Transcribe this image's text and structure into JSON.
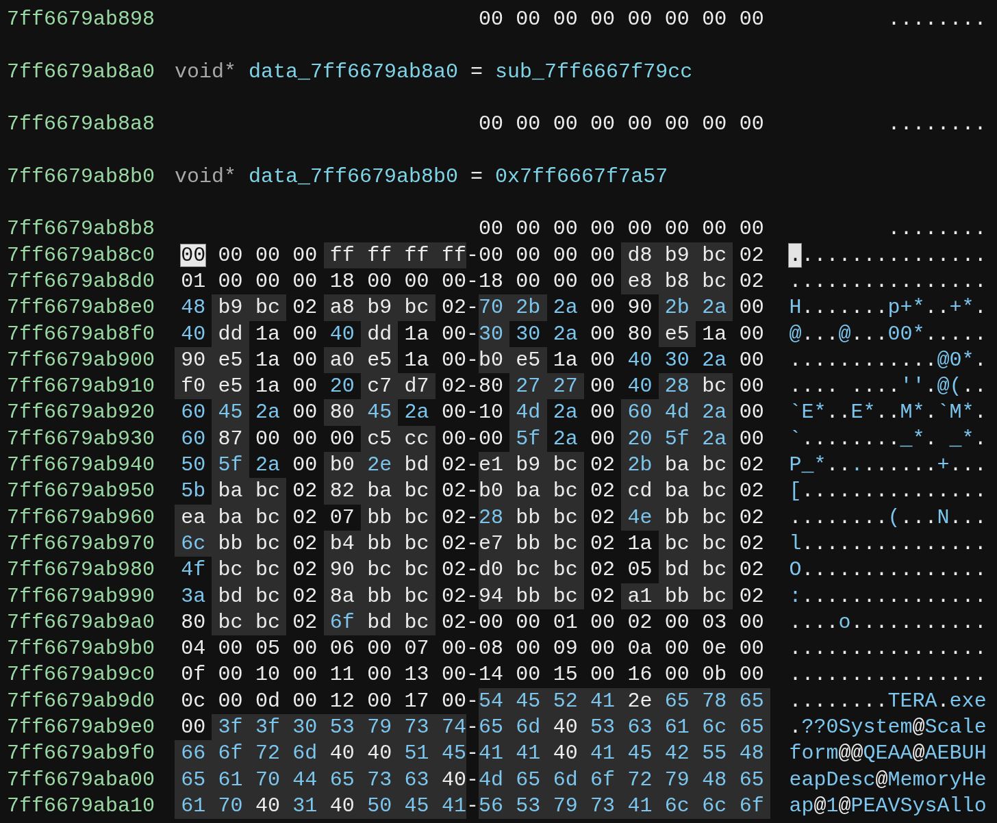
{
  "rows": [
    {
      "kind": "partial",
      "address": "7ff6679ab898",
      "bytes": [
        "00",
        "00",
        "00",
        "00",
        "00",
        "00",
        "00",
        "00"
      ],
      "ascii": "........"
    },
    {
      "kind": "declaration",
      "address": "7ff6679ab8a0",
      "type": "void*",
      "name": "data_7ff6679ab8a0",
      "operator": "=",
      "value": "sub_7ff6667f79cc"
    },
    {
      "kind": "partial",
      "address": "7ff6679ab8a8",
      "bytes": [
        "00",
        "00",
        "00",
        "00",
        "00",
        "00",
        "00",
        "00"
      ],
      "ascii": "........"
    },
    {
      "kind": "declaration",
      "address": "7ff6679ab8b0",
      "type": "void*",
      "name": "data_7ff6679ab8b0",
      "operator": "=",
      "value": "0x7ff6667f7a57"
    },
    {
      "kind": "partial",
      "address": "7ff6679ab8b8",
      "bytes": [
        "00",
        "00",
        "00",
        "00",
        "00",
        "00",
        "00",
        "00"
      ],
      "ascii": "........"
    },
    {
      "kind": "hex",
      "address": "7ff6679ab8c0",
      "selected": true,
      "separator": "-",
      "ascii": "................",
      "bytes": [
        "00",
        "00",
        "00",
        "00",
        "ff",
        "ff",
        "ff",
        "ff",
        "00",
        "00",
        "00",
        "00",
        "d8",
        "b9",
        "bc",
        "02"
      ],
      "printable": [
        false,
        false,
        false,
        false,
        false,
        false,
        false,
        false,
        false,
        false,
        false,
        false,
        false,
        false,
        false,
        false
      ],
      "shaded": [
        false,
        false,
        false,
        false,
        true,
        true,
        true,
        true,
        false,
        false,
        false,
        false,
        true,
        true,
        true,
        false
      ]
    },
    {
      "kind": "hex",
      "address": "7ff6679ab8d0",
      "selected": false,
      "separator": "-",
      "ascii": "................",
      "bytes": [
        "01",
        "00",
        "00",
        "00",
        "18",
        "00",
        "00",
        "00",
        "18",
        "00",
        "00",
        "00",
        "e8",
        "b8",
        "bc",
        "02"
      ],
      "printable": [
        false,
        false,
        false,
        false,
        false,
        false,
        false,
        false,
        false,
        false,
        false,
        false,
        false,
        false,
        false,
        false
      ],
      "shaded": [
        false,
        false,
        false,
        false,
        false,
        false,
        false,
        false,
        false,
        false,
        false,
        false,
        true,
        true,
        true,
        false
      ]
    },
    {
      "kind": "hex",
      "address": "7ff6679ab8e0",
      "selected": false,
      "separator": "-",
      "ascii": "H.......p+*..+*.",
      "bytes": [
        "48",
        "b9",
        "bc",
        "02",
        "a8",
        "b9",
        "bc",
        "02",
        "70",
        "2b",
        "2a",
        "00",
        "90",
        "2b",
        "2a",
        "00"
      ],
      "printable": [
        true,
        false,
        false,
        false,
        false,
        false,
        false,
        false,
        true,
        true,
        true,
        false,
        false,
        true,
        true,
        false
      ],
      "shaded": [
        false,
        true,
        true,
        false,
        true,
        true,
        true,
        false,
        true,
        true,
        false,
        false,
        false,
        true,
        true,
        false
      ]
    },
    {
      "kind": "hex",
      "address": "7ff6679ab8f0",
      "selected": false,
      "separator": "-",
      "ascii": "@...@...00*.....",
      "bytes": [
        "40",
        "dd",
        "1a",
        "00",
        "40",
        "dd",
        "1a",
        "00",
        "30",
        "30",
        "2a",
        "00",
        "80",
        "e5",
        "1a",
        "00"
      ],
      "printable": [
        true,
        false,
        false,
        false,
        true,
        false,
        false,
        false,
        true,
        true,
        true,
        false,
        false,
        false,
        false,
        false
      ],
      "shaded": [
        false,
        true,
        false,
        false,
        false,
        true,
        false,
        false,
        true,
        false,
        false,
        false,
        false,
        true,
        false,
        false
      ]
    },
    {
      "kind": "hex",
      "address": "7ff6679ab900",
      "selected": false,
      "separator": "-",
      "ascii": "............@0*.",
      "bytes": [
        "90",
        "e5",
        "1a",
        "00",
        "a0",
        "e5",
        "1a",
        "00",
        "b0",
        "e5",
        "1a",
        "00",
        "40",
        "30",
        "2a",
        "00"
      ],
      "printable": [
        false,
        false,
        false,
        false,
        false,
        false,
        false,
        false,
        false,
        false,
        false,
        false,
        true,
        true,
        true,
        false
      ],
      "shaded": [
        true,
        true,
        false,
        false,
        true,
        true,
        false,
        false,
        true,
        true,
        false,
        false,
        false,
        false,
        false,
        false
      ]
    },
    {
      "kind": "hex",
      "address": "7ff6679ab910",
      "selected": false,
      "separator": "-",
      "ascii": ".... ....''.@(..",
      "bytes": [
        "f0",
        "e5",
        "1a",
        "00",
        "20",
        "c7",
        "d7",
        "02",
        "80",
        "27",
        "27",
        "00",
        "40",
        "28",
        "bc",
        "00"
      ],
      "printable": [
        false,
        false,
        false,
        false,
        true,
        false,
        false,
        false,
        false,
        true,
        true,
        false,
        true,
        true,
        false,
        false
      ],
      "shaded": [
        true,
        true,
        false,
        false,
        false,
        true,
        true,
        false,
        false,
        true,
        true,
        false,
        false,
        true,
        true,
        false
      ]
    },
    {
      "kind": "hex",
      "address": "7ff6679ab920",
      "selected": false,
      "separator": "-",
      "ascii": "`E*..E*..M*.`M*.",
      "bytes": [
        "60",
        "45",
        "2a",
        "00",
        "80",
        "45",
        "2a",
        "00",
        "10",
        "4d",
        "2a",
        "00",
        "60",
        "4d",
        "2a",
        "00"
      ],
      "printable": [
        true,
        true,
        true,
        false,
        false,
        true,
        true,
        false,
        false,
        true,
        true,
        false,
        true,
        true,
        true,
        false
      ],
      "shaded": [
        false,
        true,
        false,
        false,
        true,
        true,
        false,
        false,
        false,
        true,
        false,
        false,
        true,
        true,
        true,
        false
      ]
    },
    {
      "kind": "hex",
      "address": "7ff6679ab930",
      "selected": false,
      "separator": "-",
      "ascii": "`........_*. _*.",
      "bytes": [
        "60",
        "87",
        "00",
        "00",
        "00",
        "c5",
        "cc",
        "00",
        "00",
        "5f",
        "2a",
        "00",
        "20",
        "5f",
        "2a",
        "00"
      ],
      "printable": [
        true,
        false,
        false,
        false,
        false,
        false,
        false,
        false,
        false,
        true,
        true,
        false,
        true,
        true,
        true,
        false
      ],
      "shaded": [
        false,
        true,
        false,
        false,
        false,
        true,
        true,
        false,
        false,
        true,
        false,
        false,
        true,
        true,
        true,
        false
      ]
    },
    {
      "kind": "hex",
      "address": "7ff6679ab940",
      "selected": false,
      "separator": "-",
      "ascii": "P_*.........+...",
      "bytes": [
        "50",
        "5f",
        "2a",
        "00",
        "b0",
        "2e",
        "bd",
        "02",
        "e1",
        "b9",
        "bc",
        "02",
        "2b",
        "ba",
        "bc",
        "02"
      ],
      "printable": [
        true,
        true,
        true,
        false,
        false,
        true,
        false,
        false,
        false,
        false,
        false,
        false,
        true,
        false,
        false,
        false
      ],
      "shaded": [
        false,
        true,
        false,
        false,
        true,
        true,
        true,
        false,
        true,
        true,
        true,
        false,
        true,
        true,
        true,
        false
      ]
    },
    {
      "kind": "hex",
      "address": "7ff6679ab950",
      "selected": false,
      "separator": "-",
      "ascii": "[...............",
      "bytes": [
        "5b",
        "ba",
        "bc",
        "02",
        "82",
        "ba",
        "bc",
        "02",
        "b0",
        "ba",
        "bc",
        "02",
        "cd",
        "ba",
        "bc",
        "02"
      ],
      "printable": [
        true,
        false,
        false,
        false,
        false,
        false,
        false,
        false,
        false,
        false,
        false,
        false,
        false,
        false,
        false,
        false
      ],
      "shaded": [
        false,
        true,
        true,
        false,
        true,
        true,
        true,
        false,
        true,
        true,
        true,
        false,
        true,
        true,
        true,
        false
      ]
    },
    {
      "kind": "hex",
      "address": "7ff6679ab960",
      "selected": false,
      "separator": "-",
      "ascii": "........(...N...",
      "bytes": [
        "ea",
        "ba",
        "bc",
        "02",
        "07",
        "bb",
        "bc",
        "02",
        "28",
        "bb",
        "bc",
        "02",
        "4e",
        "bb",
        "bc",
        "02"
      ],
      "printable": [
        false,
        false,
        false,
        false,
        false,
        false,
        false,
        false,
        true,
        false,
        false,
        false,
        true,
        false,
        false,
        false
      ],
      "shaded": [
        true,
        true,
        true,
        false,
        false,
        true,
        true,
        false,
        true,
        true,
        true,
        false,
        true,
        true,
        true,
        false
      ]
    },
    {
      "kind": "hex",
      "address": "7ff6679ab970",
      "selected": false,
      "separator": "-",
      "ascii": "l...............",
      "bytes": [
        "6c",
        "bb",
        "bc",
        "02",
        "b4",
        "bb",
        "bc",
        "02",
        "e7",
        "bb",
        "bc",
        "02",
        "1a",
        "bc",
        "bc",
        "02"
      ],
      "printable": [
        true,
        false,
        false,
        false,
        false,
        false,
        false,
        false,
        false,
        false,
        false,
        false,
        false,
        false,
        false,
        false
      ],
      "shaded": [
        true,
        true,
        true,
        false,
        true,
        true,
        true,
        false,
        true,
        true,
        true,
        false,
        false,
        true,
        true,
        false
      ]
    },
    {
      "kind": "hex",
      "address": "7ff6679ab980",
      "selected": false,
      "separator": "-",
      "ascii": "O...............",
      "bytes": [
        "4f",
        "bc",
        "bc",
        "02",
        "90",
        "bc",
        "bc",
        "02",
        "d0",
        "bc",
        "bc",
        "02",
        "05",
        "bd",
        "bc",
        "02"
      ],
      "printable": [
        true,
        false,
        false,
        false,
        false,
        false,
        false,
        false,
        false,
        false,
        false,
        false,
        false,
        false,
        false,
        false
      ],
      "shaded": [
        false,
        true,
        true,
        false,
        true,
        true,
        true,
        false,
        true,
        true,
        true,
        false,
        false,
        true,
        true,
        false
      ]
    },
    {
      "kind": "hex",
      "address": "7ff6679ab990",
      "selected": false,
      "separator": "-",
      "ascii": ":...............",
      "bytes": [
        "3a",
        "bd",
        "bc",
        "02",
        "8a",
        "bb",
        "bc",
        "02",
        "94",
        "bb",
        "bc",
        "02",
        "a1",
        "bb",
        "bc",
        "02"
      ],
      "printable": [
        true,
        false,
        false,
        false,
        false,
        false,
        false,
        false,
        false,
        false,
        false,
        false,
        false,
        false,
        false,
        false
      ],
      "shaded": [
        false,
        true,
        true,
        false,
        true,
        true,
        true,
        false,
        true,
        true,
        true,
        false,
        true,
        true,
        true,
        false
      ]
    },
    {
      "kind": "hex",
      "address": "7ff6679ab9a0",
      "selected": false,
      "separator": "-",
      "ascii": "....o...........",
      "bytes": [
        "80",
        "bc",
        "bc",
        "02",
        "6f",
        "bd",
        "bc",
        "02",
        "00",
        "00",
        "01",
        "00",
        "02",
        "00",
        "03",
        "00"
      ],
      "printable": [
        false,
        false,
        false,
        false,
        true,
        false,
        false,
        false,
        false,
        false,
        false,
        false,
        false,
        false,
        false,
        false
      ],
      "shaded": [
        false,
        true,
        true,
        false,
        true,
        true,
        true,
        false,
        false,
        false,
        false,
        false,
        false,
        false,
        false,
        false
      ]
    },
    {
      "kind": "hex",
      "address": "7ff6679ab9b0",
      "selected": false,
      "separator": "-",
      "ascii": "................",
      "bytes": [
        "04",
        "00",
        "05",
        "00",
        "06",
        "00",
        "07",
        "00",
        "08",
        "00",
        "09",
        "00",
        "0a",
        "00",
        "0e",
        "00"
      ],
      "printable": [
        false,
        false,
        false,
        false,
        false,
        false,
        false,
        false,
        false,
        false,
        false,
        false,
        false,
        false,
        false,
        false
      ],
      "shaded": [
        false,
        false,
        false,
        false,
        false,
        false,
        false,
        false,
        false,
        false,
        false,
        false,
        false,
        false,
        false,
        false
      ]
    },
    {
      "kind": "hex",
      "address": "7ff6679ab9c0",
      "selected": false,
      "separator": "-",
      "ascii": "................",
      "bytes": [
        "0f",
        "00",
        "10",
        "00",
        "11",
        "00",
        "13",
        "00",
        "14",
        "00",
        "15",
        "00",
        "16",
        "00",
        "0b",
        "00"
      ],
      "printable": [
        false,
        false,
        false,
        false,
        false,
        false,
        false,
        false,
        false,
        false,
        false,
        false,
        false,
        false,
        false,
        false
      ],
      "shaded": [
        false,
        false,
        false,
        false,
        false,
        false,
        false,
        false,
        false,
        false,
        false,
        false,
        false,
        false,
        false,
        false
      ]
    },
    {
      "kind": "hex",
      "address": "7ff6679ab9d0",
      "selected": false,
      "separator": "-",
      "ascii": "........TERA.exe",
      "bytes": [
        "0c",
        "00",
        "0d",
        "00",
        "12",
        "00",
        "17",
        "00",
        "54",
        "45",
        "52",
        "41",
        "2e",
        "65",
        "78",
        "65"
      ],
      "printable": [
        false,
        false,
        false,
        false,
        false,
        false,
        false,
        false,
        true,
        true,
        true,
        true,
        false,
        true,
        true,
        true
      ],
      "shaded": [
        false,
        false,
        false,
        false,
        false,
        false,
        false,
        false,
        true,
        true,
        true,
        true,
        true,
        true,
        true,
        true
      ]
    },
    {
      "kind": "hex",
      "address": "7ff6679ab9e0",
      "selected": false,
      "separator": "-",
      "ascii": ".??0System@Scale",
      "bytes": [
        "00",
        "3f",
        "3f",
        "30",
        "53",
        "79",
        "73",
        "74",
        "65",
        "6d",
        "40",
        "53",
        "63",
        "61",
        "6c",
        "65"
      ],
      "printable": [
        false,
        true,
        true,
        true,
        true,
        true,
        true,
        true,
        true,
        true,
        false,
        true,
        true,
        true,
        true,
        true
      ],
      "shaded": [
        false,
        true,
        true,
        true,
        true,
        true,
        true,
        true,
        true,
        true,
        true,
        true,
        true,
        true,
        true,
        true
      ]
    },
    {
      "kind": "hex",
      "address": "7ff6679ab9f0",
      "selected": false,
      "separator": "-",
      "ascii": "form@@QEAA@AEBUH",
      "bytes": [
        "66",
        "6f",
        "72",
        "6d",
        "40",
        "40",
        "51",
        "45",
        "41",
        "41",
        "40",
        "41",
        "45",
        "42",
        "55",
        "48"
      ],
      "printable": [
        true,
        true,
        true,
        true,
        false,
        false,
        true,
        true,
        true,
        true,
        false,
        true,
        true,
        true,
        true,
        true
      ],
      "shaded": [
        true,
        true,
        true,
        true,
        true,
        true,
        true,
        true,
        true,
        true,
        true,
        true,
        true,
        true,
        true,
        true
      ]
    },
    {
      "kind": "hex",
      "address": "7ff6679aba00",
      "selected": false,
      "separator": "-",
      "ascii": "eapDesc@MemoryHe",
      "bytes": [
        "65",
        "61",
        "70",
        "44",
        "65",
        "73",
        "63",
        "40",
        "4d",
        "65",
        "6d",
        "6f",
        "72",
        "79",
        "48",
        "65"
      ],
      "printable": [
        true,
        true,
        true,
        true,
        true,
        true,
        true,
        false,
        true,
        true,
        true,
        true,
        true,
        true,
        true,
        true
      ],
      "shaded": [
        true,
        true,
        true,
        true,
        true,
        true,
        true,
        true,
        true,
        true,
        true,
        true,
        true,
        true,
        true,
        true
      ]
    },
    {
      "kind": "hex",
      "address": "7ff6679aba10",
      "selected": false,
      "separator": "-",
      "ascii": "ap@1@PEAVSysAllo",
      "bytes": [
        "61",
        "70",
        "40",
        "31",
        "40",
        "50",
        "45",
        "41",
        "56",
        "53",
        "79",
        "73",
        "41",
        "6c",
        "6c",
        "6f"
      ],
      "printable": [
        true,
        true,
        false,
        true,
        false,
        true,
        true,
        true,
        true,
        true,
        true,
        true,
        true,
        true,
        true,
        true
      ],
      "shaded": [
        true,
        true,
        true,
        true,
        true,
        true,
        true,
        true,
        true,
        true,
        true,
        true,
        true,
        true,
        true,
        true
      ]
    }
  ]
}
